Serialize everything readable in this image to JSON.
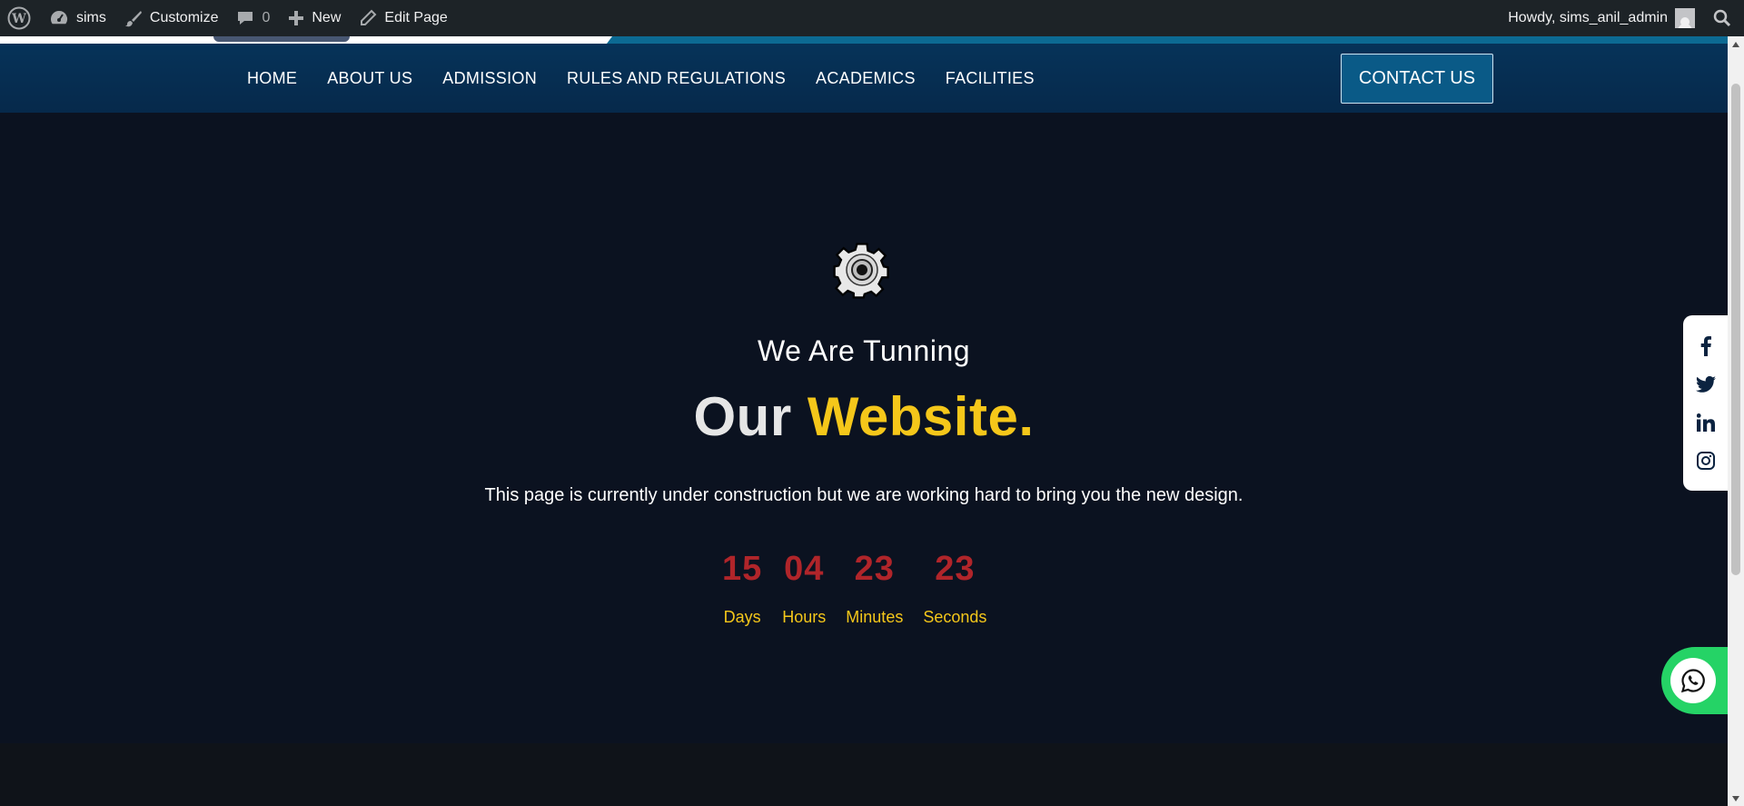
{
  "admin_bar": {
    "site_name": "sims",
    "customize": "Customize",
    "comments_count": "0",
    "new": "New",
    "edit_page": "Edit Page",
    "howdy": "Howdy, sims_anil_admin"
  },
  "nav": {
    "items": [
      "HOME",
      "ABOUT US",
      "ADMISSION",
      "RULES AND REGULATIONS",
      "ACADEMICS",
      "FACILITIES"
    ],
    "contact": "CONTACT US"
  },
  "hero": {
    "subtitle": "We Are Tunning",
    "title_part1": "Our",
    "title_part2": "Website.",
    "description": "This page is currently under construction but we are working hard to bring you the new design.",
    "countdown": [
      {
        "value": "15",
        "label": "Days"
      },
      {
        "value": "04",
        "label": "Hours"
      },
      {
        "value": "23",
        "label": "Minutes"
      },
      {
        "value": "23",
        "label": "Seconds"
      }
    ]
  },
  "social": [
    "facebook-icon",
    "twitter-icon",
    "linkedin-icon",
    "instagram-icon"
  ],
  "colors": {
    "admin_bar": "#1d2327",
    "navbar": "#063359",
    "hero_bg": "#0b1220",
    "accent_yellow": "#f5c71a",
    "countdown_red": "#b0252a",
    "whatsapp": "#25d366"
  }
}
